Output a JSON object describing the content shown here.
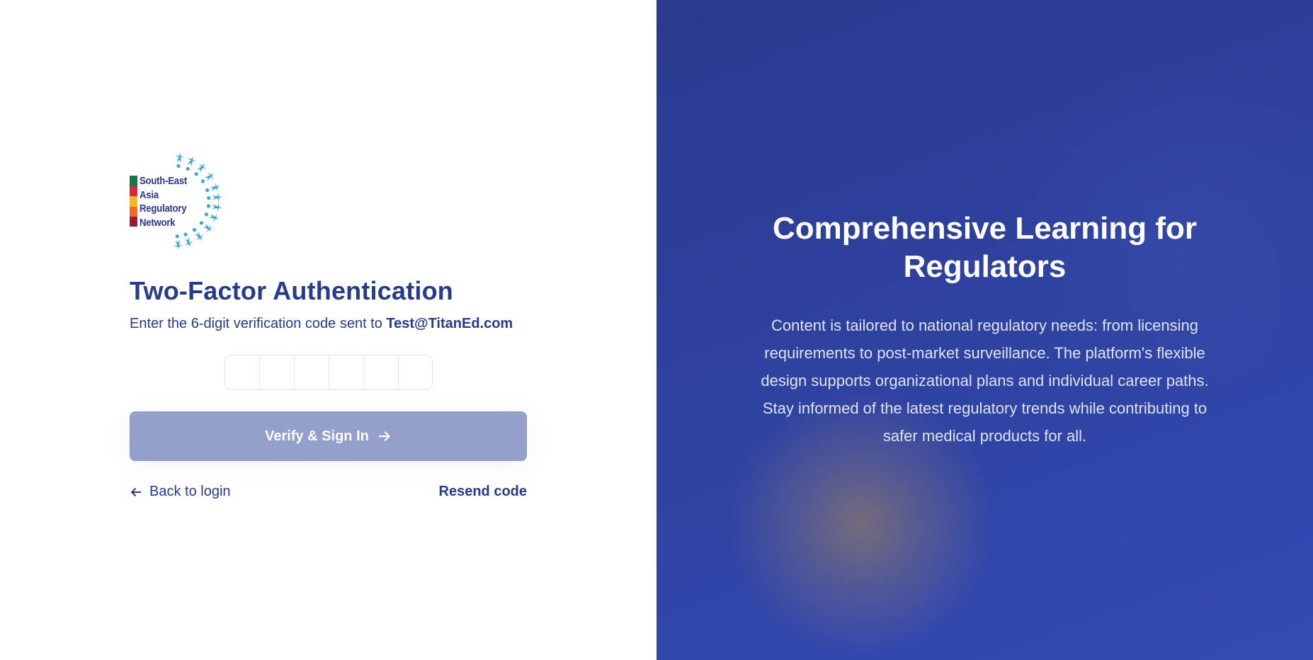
{
  "logo": {
    "lines": [
      "South-East",
      "Asia",
      "Regulatory",
      "Network"
    ],
    "bar_colors": [
      "#0f7a4a",
      "#e8213a",
      "#fbb81b",
      "#f26722",
      "#9b1b30"
    ],
    "figure_color": "#3ba6dd"
  },
  "auth": {
    "title": "Two-Factor Authentication",
    "subtitle_prefix": "Enter the 6-digit verification code sent to ",
    "email": "Test@TitanEd.com",
    "otp_digits": [
      "",
      "",
      "",
      "",
      "",
      ""
    ],
    "verify_label": "Verify & Sign In",
    "back_label": "Back to login",
    "resend_label": "Resend code"
  },
  "promo": {
    "heading_line1": "Comprehensive Learning for",
    "heading_line2": "Regulators",
    "body": "Content is tailored to national regulatory needs: from licensing requirements to post-market surveillance. The platform's flexible design supports organizational plans and individual career paths. Stay informed of the latest regulatory trends while contributing to safer medical products for all."
  },
  "colors": {
    "brand": "#283a8e",
    "button_disabled": "#949fcb",
    "panel_start": "#293a8f",
    "panel_end": "#344bb6"
  },
  "icons": {
    "arrow_right": "arrow-right-icon",
    "arrow_left": "arrow-left-icon"
  }
}
